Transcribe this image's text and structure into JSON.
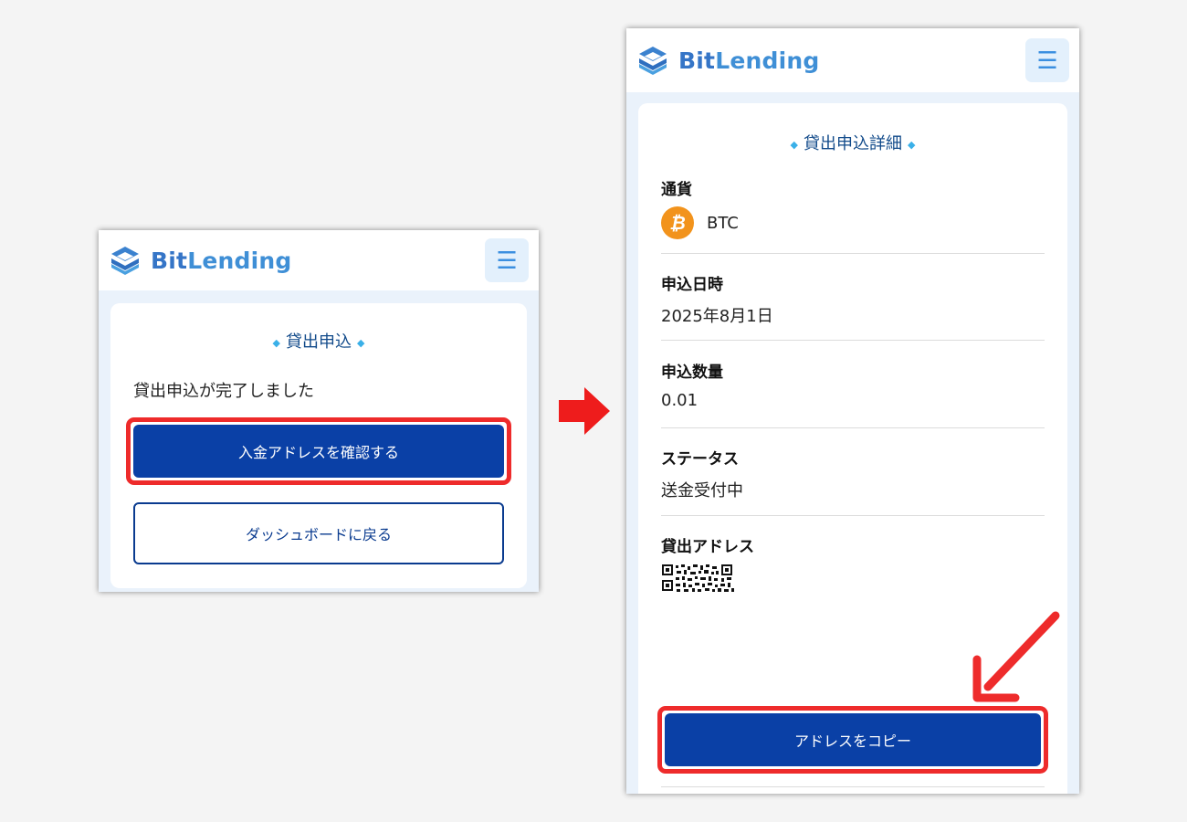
{
  "brand": {
    "part1": "Bit",
    "part2": "Lending"
  },
  "menu_icon": "hamburger-menu-icon",
  "left_screen": {
    "section_title": "貸出申込",
    "message": "貸出申込が完了しました",
    "primary_button": "入金アドレスを確認する",
    "secondary_button": "ダッシュボードに戻る"
  },
  "right_screen": {
    "section_title": "貸出申込詳細",
    "fields": [
      {
        "label": "通貨",
        "value": "BTC"
      },
      {
        "label": "申込日時",
        "value": "2025年8月1日"
      },
      {
        "label": "申込数量",
        "value": "0.01"
      },
      {
        "label": "ステータス",
        "value": "送金受付中"
      },
      {
        "label": "貸出アドレス"
      }
    ],
    "copy_button": "アドレスをコピー"
  },
  "colors": {
    "primary": "#0a40a6",
    "highlight": "#ee2b2b",
    "accent": "#3ab0e8",
    "btc": "#f2931c"
  }
}
